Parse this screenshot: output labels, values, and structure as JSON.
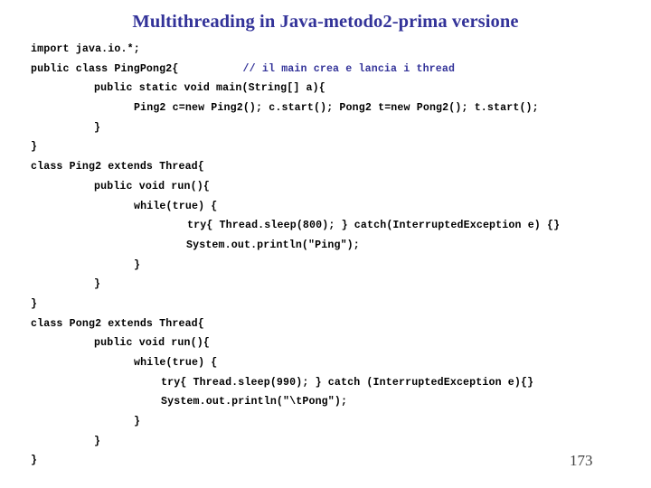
{
  "slide": {
    "title": "Multithreading in Java-metodo2-prima versione",
    "page_number": "173",
    "title_color": "#333399",
    "comment_color": "#333399",
    "code_color": "#000000",
    "background_color": "#ffffff"
  },
  "code": {
    "lines": [
      {
        "indent": 34,
        "text": "import java.io.*;",
        "comment": ""
      },
      {
        "indent": 34,
        "text": "public class PingPong2{",
        "comment": "          // il main crea e lancia i thread"
      },
      {
        "indent": 104,
        "text": "public static void main(String[] a){",
        "comment": ""
      },
      {
        "indent": 148,
        "text": "Ping2 c=new Ping2(); c.start(); Pong2 t=new Pong2(); t.start();",
        "comment": ""
      },
      {
        "indent": 104,
        "text": "}",
        "comment": ""
      },
      {
        "indent": 34,
        "text": "}",
        "comment": ""
      },
      {
        "indent": 34,
        "text": "class Ping2 extends Thread{",
        "comment": ""
      },
      {
        "indent": 104,
        "text": "public void run(){",
        "comment": ""
      },
      {
        "indent": 148,
        "text": "while(true) {",
        "comment": ""
      },
      {
        "indent": 207,
        "text": "try{ Thread.sleep(800); } catch(InterruptedException e) {}",
        "comment": ""
      },
      {
        "indent": 206,
        "text": "System.out.println(\"Ping\");",
        "comment": ""
      },
      {
        "indent": 148,
        "text": "}",
        "comment": ""
      },
      {
        "indent": 104,
        "text": "}",
        "comment": ""
      },
      {
        "indent": 34,
        "text": "}",
        "comment": ""
      },
      {
        "indent": 34,
        "text": "class Pong2 extends Thread{",
        "comment": ""
      },
      {
        "indent": 104,
        "text": "public void run(){",
        "comment": ""
      },
      {
        "indent": 148,
        "text": "while(true) {",
        "comment": ""
      },
      {
        "indent": 178,
        "text": "try{ Thread.sleep(990); } catch (InterruptedException e){}",
        "comment": ""
      },
      {
        "indent": 178,
        "text": "System.out.println(\"\\tPong\");",
        "comment": ""
      },
      {
        "indent": 148,
        "text": "}",
        "comment": ""
      },
      {
        "indent": 104,
        "text": "}",
        "comment": ""
      },
      {
        "indent": 34,
        "text": "}",
        "comment": ""
      }
    ]
  }
}
